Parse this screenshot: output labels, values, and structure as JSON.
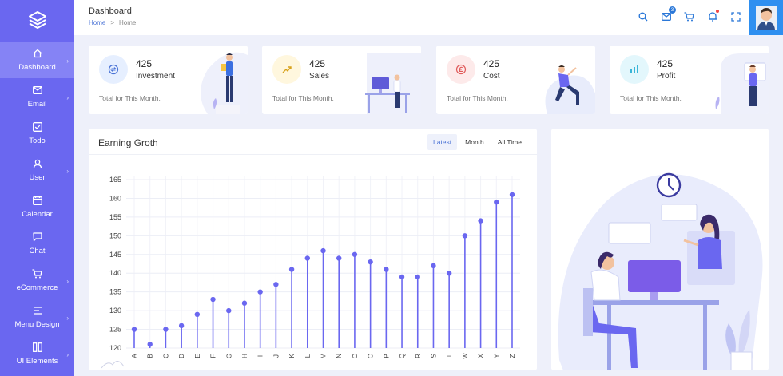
{
  "sidebar": {
    "items": [
      {
        "label": "Dashboard",
        "icon": "home-icon",
        "active": true,
        "chevron": true
      },
      {
        "label": "Email",
        "icon": "mail-icon",
        "chevron": true
      },
      {
        "label": "Todo",
        "icon": "todo-icon",
        "chevron": false
      },
      {
        "label": "User",
        "icon": "user-icon",
        "chevron": true
      },
      {
        "label": "Calendar",
        "icon": "calendar-icon",
        "chevron": false
      },
      {
        "label": "Chat",
        "icon": "chat-icon",
        "chevron": false
      },
      {
        "label": "eCommerce",
        "icon": "cart-icon",
        "chevron": true
      },
      {
        "label": "Menu Design",
        "icon": "menu-icon",
        "chevron": true
      },
      {
        "label": "UI Elements",
        "icon": "ui-elements-icon",
        "chevron": true
      }
    ]
  },
  "header": {
    "title": "Dashboard",
    "breadcrumb_home": "Home",
    "breadcrumb_sep": ">",
    "breadcrumb_current": "Home",
    "mail_badge": "3"
  },
  "cards": [
    {
      "value": "425",
      "label": "Investment",
      "sub": "Total for This Month.",
      "icon": "exchange-icon",
      "color": "#4a73d6",
      "bg": "#e6efff"
    },
    {
      "value": "425",
      "label": "Sales",
      "sub": "Total for This Month.",
      "icon": "sales-icon",
      "color": "#d8a21c",
      "bg": "#fff7de"
    },
    {
      "value": "425",
      "label": "Cost",
      "sub": "Total for This Month.",
      "icon": "currency-icon",
      "color": "#e05a5a",
      "bg": "#fdeaea"
    },
    {
      "value": "425",
      "label": "Profit",
      "sub": "Total for This Month.",
      "icon": "bar-chart-icon",
      "color": "#3ab6d8",
      "bg": "#e3f7fc"
    }
  ],
  "chart_panel": {
    "title": "Earning Groth",
    "tabs": [
      "Latest",
      "Month",
      "All Time"
    ],
    "active_tab": "Latest"
  },
  "chart_data": {
    "type": "scatter",
    "title": "Earning Groth",
    "categories": [
      "A",
      "B",
      "C",
      "D",
      "E",
      "F",
      "G",
      "H",
      "I",
      "J",
      "K",
      "L",
      "M",
      "N",
      "O",
      "O",
      "P",
      "Q",
      "R",
      "S",
      "T",
      "W",
      "X",
      "Y",
      "Z"
    ],
    "values": [
      125,
      121,
      125,
      126,
      129,
      133,
      130,
      132,
      135,
      137,
      141,
      144,
      146,
      144,
      145,
      143,
      141,
      139,
      139,
      142,
      140,
      150,
      154,
      159,
      161
    ],
    "yticks": [
      120,
      125,
      130,
      135,
      140,
      145,
      150,
      155,
      160,
      165
    ],
    "ylim": [
      120,
      165
    ],
    "grid": true,
    "color": "#6a67f0"
  },
  "colors": {
    "sidebar": "#6a67f0",
    "accent": "#4a73d6",
    "avatar_bg": "#2e8ff0"
  }
}
